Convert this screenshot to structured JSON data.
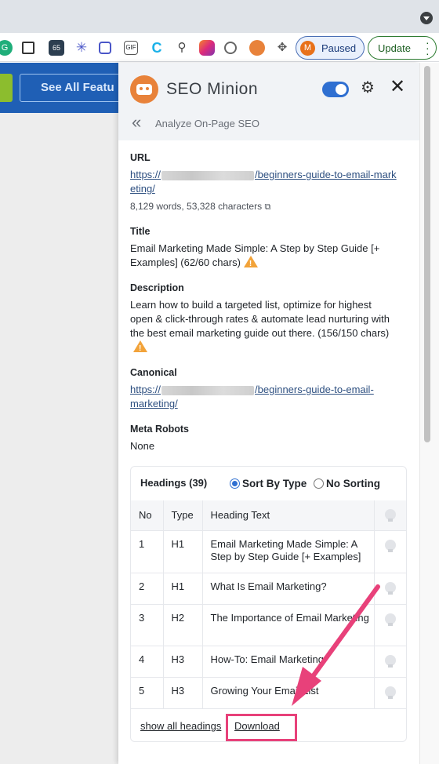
{
  "browser": {
    "paused_avatar": "M",
    "paused_label": "Paused",
    "update_label": "Update",
    "extensions": [
      "G",
      "crop-icon",
      "65",
      "asterisk-icon",
      "doc-icon",
      "GIF",
      "C",
      "magnifier-icon",
      "camera-icon",
      "block-icon",
      "robot-icon",
      "puzzle-icon"
    ]
  },
  "page": {
    "cta_label": "See All Featu"
  },
  "panel": {
    "brand": "SEO Minion",
    "toggle_on": true,
    "back_label": "Analyze On-Page SEO",
    "url": {
      "label": "URL",
      "prefix": "https://",
      "suffix_line1": "/beginners-guide-to-email-mark",
      "suffix_line2": "eting/",
      "stats": "8,129 words, 53,328 characters"
    },
    "title": {
      "label": "Title",
      "value": "Email Marketing Made Simple: A Step by Step Guide [+ Examples] (62/60 chars)"
    },
    "description": {
      "label": "Description",
      "value": "Learn how to build a targeted list, optimize for highest open & click-through rates & automate lead nurturing with the best email marketing guide out there. (156/150 chars)"
    },
    "canonical": {
      "label": "Canonical",
      "prefix": "https://",
      "suffix_line1": "/beginners-guide-to-email-",
      "suffix_line2": "marketing/"
    },
    "meta_robots": {
      "label": "Meta Robots",
      "value": "None"
    },
    "headings": {
      "title": "Headings (39)",
      "sort_by_type": "Sort By Type",
      "no_sorting": "No Sorting",
      "selected": "Sort By Type",
      "columns": [
        "No",
        "Type",
        "Heading Text"
      ],
      "rows": [
        {
          "no": "1",
          "type": "H1",
          "text": "Email Marketing Made Simple: A Step by Step Guide [+ Examples]"
        },
        {
          "no": "2",
          "type": "H1",
          "text": "What Is Email Marketing?"
        },
        {
          "no": "3",
          "type": "H2",
          "text": "The Importance of Email Marketing"
        },
        {
          "no": "4",
          "type": "H3",
          "text": "How-To: Email Marketing"
        },
        {
          "no": "5",
          "type": "H3",
          "text": "Growing Your Email List"
        }
      ],
      "show_all": "show all headings",
      "download": "Download"
    }
  },
  "colors": {
    "accent": "#2f6fd1",
    "brand_orange": "#e8823a",
    "annotation_pink": "#e8417a",
    "warning": "#f2a33a"
  }
}
